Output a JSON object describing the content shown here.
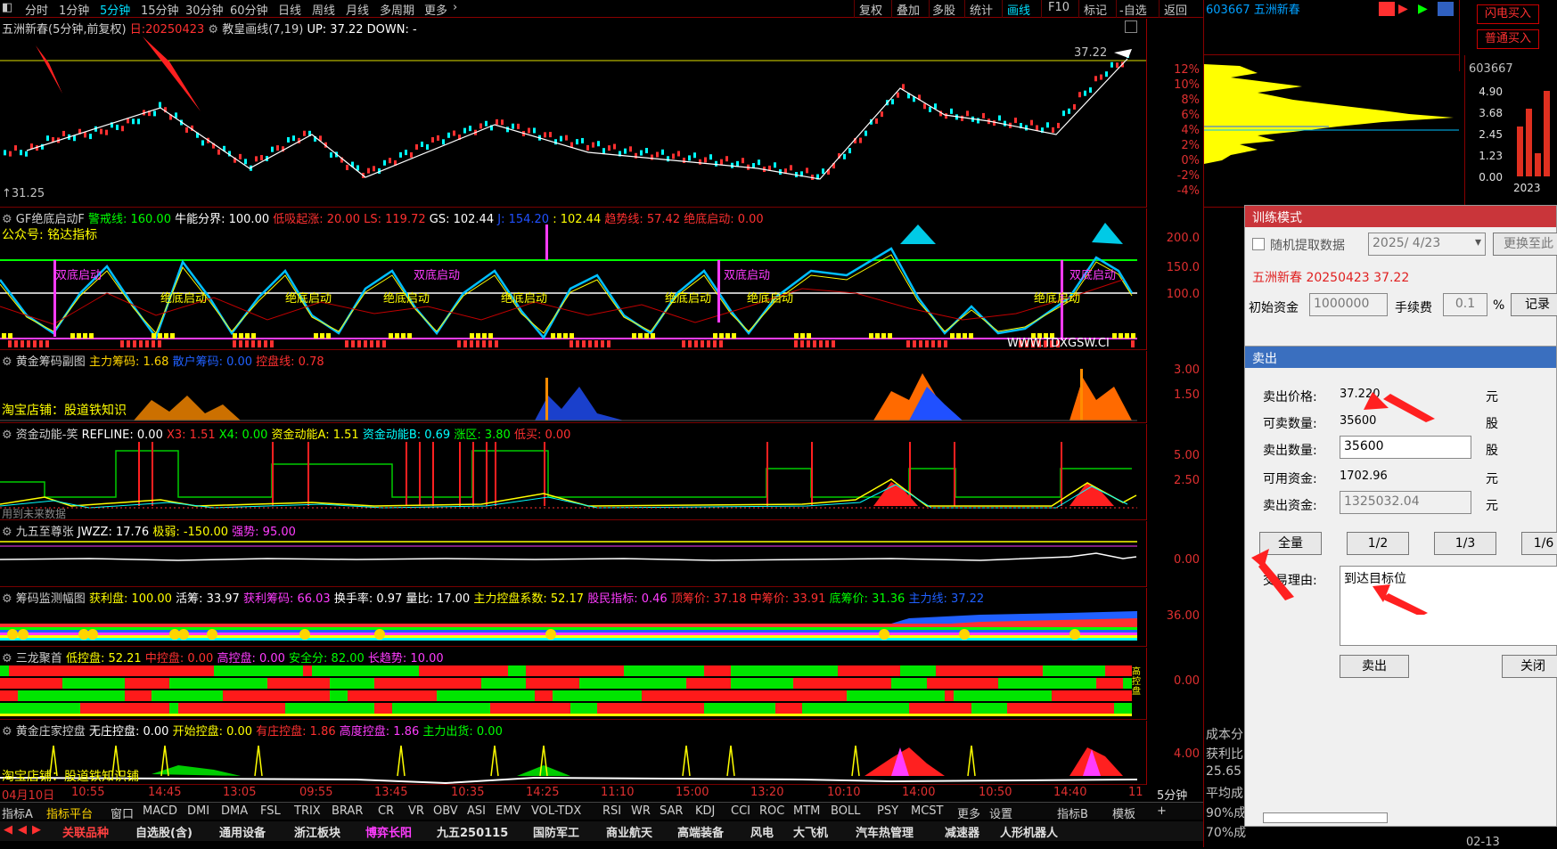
{
  "toolbar": {
    "periods": [
      "分时",
      "1分钟",
      "5分钟",
      "15分钟",
      "30分钟",
      "60分钟",
      "日线",
      "周线",
      "月线",
      "多周期",
      "更多"
    ],
    "active_period": "5分钟",
    "right_items": [
      "复权",
      "叠加",
      "多股",
      "统计",
      "画线",
      "F10",
      "标记",
      "-自选",
      "返回"
    ],
    "active_right": "画线"
  },
  "main_panel": {
    "title": "五洲新春(5分钟,前复权)",
    "date_label": "日:20250423",
    "indicator": "教皇画线(7,19)",
    "up_label": "UP: 37.22",
    "down_label": "DOWN: -",
    "price_marker": "37.22",
    "low_label": "↑31.25",
    "axis": [
      "12%",
      "10%",
      "8%",
      "6%",
      "4%",
      "2%",
      "0%",
      "-2%",
      "-4%"
    ]
  },
  "panel2": {
    "name": "GF绝底启动F",
    "items": [
      {
        "t": "警戒线: 160.00",
        "c": "#00ff00"
      },
      {
        "t": "牛能分界: 100.00",
        "c": "#ffffff"
      },
      {
        "t": "低吸起涨: 20.00",
        "c": "#ff3030"
      },
      {
        "t": "LS: 119.72",
        "c": "#ff3030"
      },
      {
        "t": "GS: 102.44",
        "c": "#ffffff"
      },
      {
        "t": "J: 154.20",
        "c": "#2050ff"
      },
      {
        "t": ": 102.44",
        "c": "#ffff00"
      },
      {
        "t": "趋势线: 57.42",
        "c": "#ff3030"
      },
      {
        "t": "绝底启动: 0.00",
        "c": "#ff3030"
      }
    ],
    "watermark": "公众号: 铭达指标",
    "axis": [
      "200.0",
      "150.0",
      "100.0"
    ],
    "labels_jd": "绝底启动",
    "labels_sd": "双底启动",
    "site": "WWW.TDXGSW.CI"
  },
  "panel3": {
    "name": "黄金筹码副图",
    "items": [
      {
        "t": "主力筹码: 1.68",
        "c": "#ffd400"
      },
      {
        "t": "散户筹码: 0.00",
        "c": "#2060ff"
      },
      {
        "t": "控盘线: 0.78",
        "c": "#ff3030"
      }
    ],
    "watermark": "淘宝店铺：股道铁知识",
    "axis": [
      "3.00",
      "1.50"
    ]
  },
  "panel4": {
    "name": "资金动能-笑",
    "items": [
      {
        "t": "REFLINE: 0.00",
        "c": "#ffffff"
      },
      {
        "t": "X3: 1.51",
        "c": "#ff3030"
      },
      {
        "t": "X4: 0.00",
        "c": "#00ff00"
      },
      {
        "t": "资金动能A: 1.51",
        "c": "#ffff00"
      },
      {
        "t": "资金动能B: 0.69",
        "c": "#00ffff"
      },
      {
        "t": "涨区: 3.80",
        "c": "#00ff00"
      },
      {
        "t": "低买: 0.00",
        "c": "#ff3030"
      }
    ],
    "watermark": "用到未来数据",
    "axis": [
      "5.00",
      "2.50"
    ]
  },
  "panel5": {
    "name": "九五至尊张",
    "items": [
      {
        "t": "JWZZ: 17.76",
        "c": "#ffffff"
      },
      {
        "t": "极弱: -150.00",
        "c": "#ffff00"
      },
      {
        "t": "强势: 95.00",
        "c": "#ff3cff"
      }
    ],
    "axis": [
      "0.00"
    ]
  },
  "panel6": {
    "name": "筹码监测幅图",
    "items": [
      {
        "t": "获利盘: 100.00",
        "c": "#ffff00"
      },
      {
        "t": "活筹: 33.97",
        "c": "#ffffff"
      },
      {
        "t": "获利筹码: 66.03",
        "c": "#ff3cff"
      },
      {
        "t": "换手率: 0.97",
        "c": "#ffffff"
      },
      {
        "t": "量比: 17.00",
        "c": "#ffffff"
      },
      {
        "t": "主力控盘系数: 52.17",
        "c": "#ffff00"
      },
      {
        "t": "股民指标: 0.46",
        "c": "#ff3cff"
      },
      {
        "t": "顶筹价: 37.18",
        "c": "#ff3030"
      },
      {
        "t": "中筹价: 33.91",
        "c": "#ff3030"
      },
      {
        "t": "底筹价: 31.36",
        "c": "#00ff00"
      },
      {
        "t": "主力线: 37.22",
        "c": "#2060ff"
      }
    ],
    "axis": [
      "36.00"
    ]
  },
  "panel7": {
    "name": "三龙聚首",
    "items": [
      {
        "t": "低控盘: 52.21",
        "c": "#ffff00"
      },
      {
        "t": "中控盘: 0.00",
        "c": "#ff3030"
      },
      {
        "t": "高控盘: 0.00",
        "c": "#ff3cff"
      },
      {
        "t": "安全分: 82.00",
        "c": "#00ff00"
      },
      {
        "t": "长趋势: 10.00",
        "c": "#ff3cff"
      }
    ],
    "axis": [
      "0.00"
    ],
    "side_text": "高控盘"
  },
  "panel8": {
    "name": "黄金庄家控盘",
    "items": [
      {
        "t": "无庄控盘: 0.00",
        "c": "#ffffff"
      },
      {
        "t": "开始控盘: 0.00",
        "c": "#ffff00"
      },
      {
        "t": "有庄控盘: 1.86",
        "c": "#ff3030"
      },
      {
        "t": "高度控盘: 1.86",
        "c": "#ff3cff"
      },
      {
        "t": "主力出货: 0.00",
        "c": "#00ff00"
      }
    ],
    "watermark": "淘宝店铺：股道铁知识铺",
    "axis": [
      "4.00"
    ]
  },
  "time_axis": [
    "04月10日",
    "10:55",
    "14:45",
    "13:05",
    "09:55",
    "13:45",
    "10:35",
    "14:25",
    "11:10",
    "15:00",
    "13:20",
    "10:10",
    "14:00",
    "10:50",
    "14:40",
    "11"
  ],
  "time_period": "5分钟",
  "index_tabs": [
    "指标A",
    "指标平台",
    "窗口",
    "MACD",
    "DMI",
    "DMA",
    "FSL",
    "TRIX",
    "BRAR",
    "CR",
    "VR",
    "OBV",
    "ASI",
    "EMV",
    "VOL-TDX",
    "RSI",
    "WR",
    "SAR",
    "KDJ",
    "CCI",
    "ROC",
    "MTM",
    "BOLL",
    "PSY",
    "MCST",
    "更多",
    "设置"
  ],
  "index_active": "指标平台",
  "index_right": [
    "指标B",
    "模板",
    "+"
  ],
  "block_tabs": [
    "关联品种",
    "自选股(含)",
    "通用设备",
    "浙江板块",
    "博弈长阳",
    "九五250115",
    "国防军工",
    "商业航天",
    "高端装备",
    "风电",
    "大飞机",
    "汽车热管理",
    "减速器",
    "人形机器人"
  ],
  "right_panel": {
    "code_name": "603667 五洲新春",
    "code": "603667",
    "buttons": [
      "闪电买入",
      "普通买入"
    ],
    "bar_axis": [
      "4.90",
      "3.68",
      "2.45",
      "1.23",
      "0.00"
    ],
    "year": "2023",
    "bottom_labels": [
      "成本分",
      "获利比",
      "25.65",
      "平均成",
      "90%成",
      "70%成"
    ],
    "bottom_date": "02-13"
  },
  "training": {
    "title": "训练模式",
    "random_label": "随机提取数据",
    "date_value": "2025/ 4/23",
    "switch_button": "更换至此",
    "stock_info": "五洲新春 20250423 37.22",
    "init_cash_label": "初始资金",
    "init_cash": "1000000",
    "fee_label": "手续费",
    "fee": "0.1",
    "pct": "%",
    "record": "记录"
  },
  "sell": {
    "title": "卖出",
    "price_label": "卖出价格:",
    "price": "37.220",
    "unit_yuan": "元",
    "avail_label": "可卖数量:",
    "avail": "35600",
    "unit_gu": "股",
    "qty_label": "卖出数量:",
    "qty": "35600",
    "cash_label": "可用资金:",
    "cash": "1702.96",
    "amount_label": "卖出资金:",
    "amount": "1325032.04",
    "ratio_buttons": [
      "全量",
      "1/2",
      "1/3",
      "1/6"
    ],
    "reason_label": "交易理由:",
    "reason": "到达目标位",
    "sell_button": "卖出",
    "close_button": "关闭"
  }
}
